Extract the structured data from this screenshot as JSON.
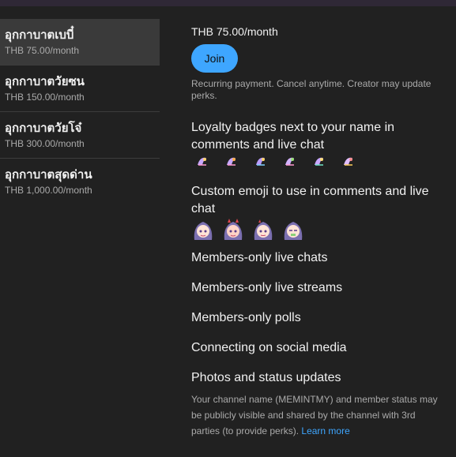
{
  "tiers": [
    {
      "name": "อุกกาบาตเบบี๋",
      "price": "THB 75.00/month"
    },
    {
      "name": "อุกกาบาตวัยซน",
      "price": "THB 150.00/month"
    },
    {
      "name": "อุกกาบาตวัยโจ๋",
      "price": "THB 300.00/month"
    },
    {
      "name": "อุกกาบาตสุดด่าน",
      "price": "THB 1,000.00/month"
    }
  ],
  "detail": {
    "price": "THB 75.00/month",
    "join_label": "Join",
    "recurring_note": "Recurring payment. Cancel anytime. Creator may update perks.",
    "perks": {
      "badges_title": "Loyalty badges next to your name in comments and live chat",
      "emoji_title": "Custom emoji to use in comments and live chat",
      "live_chats": "Members-only live chats",
      "live_streams": "Members-only live streams",
      "polls": "Members-only polls",
      "social": "Connecting on social media",
      "photos": "Photos and status updates"
    },
    "disclaimer": "Your channel name (MEMINTMY) and member status may be publicly visible and shared by the channel with 3rd parties (to provide perks).",
    "learn_more": "Learn more"
  },
  "colors": {
    "accent": "#3ea6ff",
    "background": "#212121",
    "selected_tier": "#3a3a3a"
  }
}
